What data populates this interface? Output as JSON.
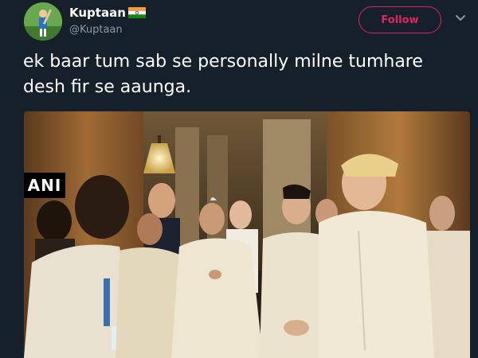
{
  "tweet": {
    "author": {
      "display_name": "Kuptaan",
      "handle": "@Kuptaan",
      "flag_icon": "india-flag-icon"
    },
    "follow_label": "Follow",
    "text": "ek baar tum sab se personally milne tumhare\ndesh fir se aaunga.",
    "media": {
      "watermark": "ANI"
    }
  },
  "colors": {
    "background": "#15202b",
    "accent": "#e0245e",
    "secondary_text": "#8899a6",
    "primary_text": "#ffffff"
  }
}
